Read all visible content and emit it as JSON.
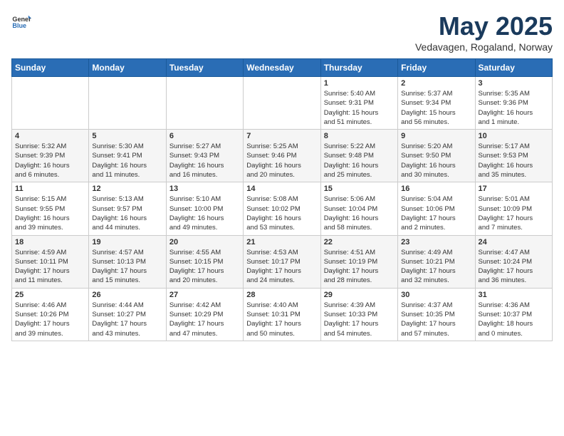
{
  "header": {
    "logo_general": "General",
    "logo_blue": "Blue",
    "month": "May 2025",
    "location": "Vedavagen, Rogaland, Norway"
  },
  "weekdays": [
    "Sunday",
    "Monday",
    "Tuesday",
    "Wednesday",
    "Thursday",
    "Friday",
    "Saturday"
  ],
  "weeks": [
    [
      {
        "day": "",
        "info": ""
      },
      {
        "day": "",
        "info": ""
      },
      {
        "day": "",
        "info": ""
      },
      {
        "day": "",
        "info": ""
      },
      {
        "day": "1",
        "info": "Sunrise: 5:40 AM\nSunset: 9:31 PM\nDaylight: 15 hours\nand 51 minutes."
      },
      {
        "day": "2",
        "info": "Sunrise: 5:37 AM\nSunset: 9:34 PM\nDaylight: 15 hours\nand 56 minutes."
      },
      {
        "day": "3",
        "info": "Sunrise: 5:35 AM\nSunset: 9:36 PM\nDaylight: 16 hours\nand 1 minute."
      }
    ],
    [
      {
        "day": "4",
        "info": "Sunrise: 5:32 AM\nSunset: 9:39 PM\nDaylight: 16 hours\nand 6 minutes."
      },
      {
        "day": "5",
        "info": "Sunrise: 5:30 AM\nSunset: 9:41 PM\nDaylight: 16 hours\nand 11 minutes."
      },
      {
        "day": "6",
        "info": "Sunrise: 5:27 AM\nSunset: 9:43 PM\nDaylight: 16 hours\nand 16 minutes."
      },
      {
        "day": "7",
        "info": "Sunrise: 5:25 AM\nSunset: 9:46 PM\nDaylight: 16 hours\nand 20 minutes."
      },
      {
        "day": "8",
        "info": "Sunrise: 5:22 AM\nSunset: 9:48 PM\nDaylight: 16 hours\nand 25 minutes."
      },
      {
        "day": "9",
        "info": "Sunrise: 5:20 AM\nSunset: 9:50 PM\nDaylight: 16 hours\nand 30 minutes."
      },
      {
        "day": "10",
        "info": "Sunrise: 5:17 AM\nSunset: 9:53 PM\nDaylight: 16 hours\nand 35 minutes."
      }
    ],
    [
      {
        "day": "11",
        "info": "Sunrise: 5:15 AM\nSunset: 9:55 PM\nDaylight: 16 hours\nand 39 minutes."
      },
      {
        "day": "12",
        "info": "Sunrise: 5:13 AM\nSunset: 9:57 PM\nDaylight: 16 hours\nand 44 minutes."
      },
      {
        "day": "13",
        "info": "Sunrise: 5:10 AM\nSunset: 10:00 PM\nDaylight: 16 hours\nand 49 minutes."
      },
      {
        "day": "14",
        "info": "Sunrise: 5:08 AM\nSunset: 10:02 PM\nDaylight: 16 hours\nand 53 minutes."
      },
      {
        "day": "15",
        "info": "Sunrise: 5:06 AM\nSunset: 10:04 PM\nDaylight: 16 hours\nand 58 minutes."
      },
      {
        "day": "16",
        "info": "Sunrise: 5:04 AM\nSunset: 10:06 PM\nDaylight: 17 hours\nand 2 minutes."
      },
      {
        "day": "17",
        "info": "Sunrise: 5:01 AM\nSunset: 10:09 PM\nDaylight: 17 hours\nand 7 minutes."
      }
    ],
    [
      {
        "day": "18",
        "info": "Sunrise: 4:59 AM\nSunset: 10:11 PM\nDaylight: 17 hours\nand 11 minutes."
      },
      {
        "day": "19",
        "info": "Sunrise: 4:57 AM\nSunset: 10:13 PM\nDaylight: 17 hours\nand 15 minutes."
      },
      {
        "day": "20",
        "info": "Sunrise: 4:55 AM\nSunset: 10:15 PM\nDaylight: 17 hours\nand 20 minutes."
      },
      {
        "day": "21",
        "info": "Sunrise: 4:53 AM\nSunset: 10:17 PM\nDaylight: 17 hours\nand 24 minutes."
      },
      {
        "day": "22",
        "info": "Sunrise: 4:51 AM\nSunset: 10:19 PM\nDaylight: 17 hours\nand 28 minutes."
      },
      {
        "day": "23",
        "info": "Sunrise: 4:49 AM\nSunset: 10:21 PM\nDaylight: 17 hours\nand 32 minutes."
      },
      {
        "day": "24",
        "info": "Sunrise: 4:47 AM\nSunset: 10:24 PM\nDaylight: 17 hours\nand 36 minutes."
      }
    ],
    [
      {
        "day": "25",
        "info": "Sunrise: 4:46 AM\nSunset: 10:26 PM\nDaylight: 17 hours\nand 39 minutes."
      },
      {
        "day": "26",
        "info": "Sunrise: 4:44 AM\nSunset: 10:27 PM\nDaylight: 17 hours\nand 43 minutes."
      },
      {
        "day": "27",
        "info": "Sunrise: 4:42 AM\nSunset: 10:29 PM\nDaylight: 17 hours\nand 47 minutes."
      },
      {
        "day": "28",
        "info": "Sunrise: 4:40 AM\nSunset: 10:31 PM\nDaylight: 17 hours\nand 50 minutes."
      },
      {
        "day": "29",
        "info": "Sunrise: 4:39 AM\nSunset: 10:33 PM\nDaylight: 17 hours\nand 54 minutes."
      },
      {
        "day": "30",
        "info": "Sunrise: 4:37 AM\nSunset: 10:35 PM\nDaylight: 17 hours\nand 57 minutes."
      },
      {
        "day": "31",
        "info": "Sunrise: 4:36 AM\nSunset: 10:37 PM\nDaylight: 18 hours\nand 0 minutes."
      }
    ]
  ]
}
